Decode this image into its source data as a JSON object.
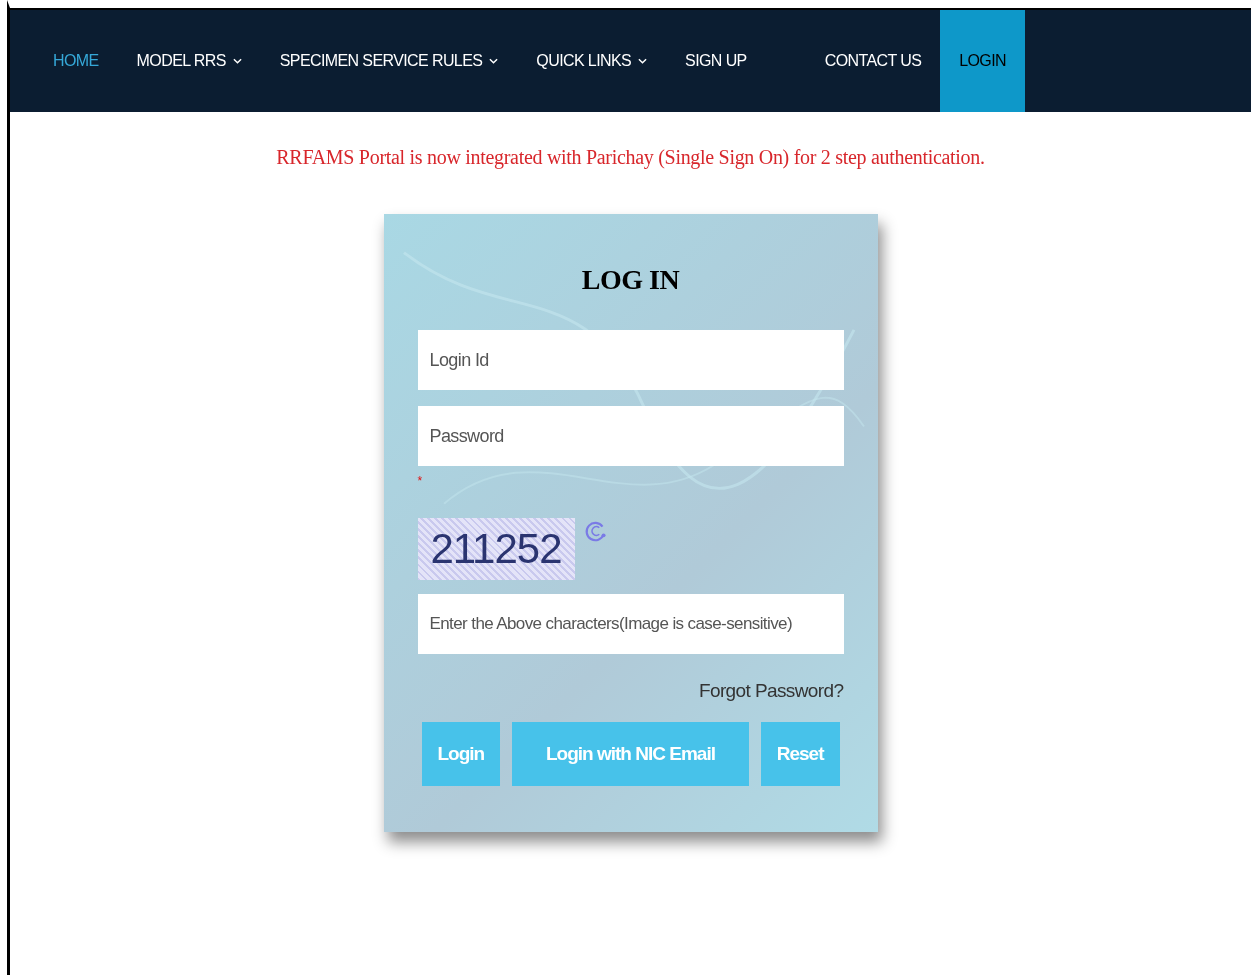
{
  "nav": {
    "items": [
      {
        "label": "HOME",
        "dropdown": false,
        "active": true,
        "selected": false
      },
      {
        "label": "MODEL RRS",
        "dropdown": true,
        "active": false,
        "selected": false
      },
      {
        "label": "SPECIMEN SERVICE RULES",
        "dropdown": true,
        "active": false,
        "selected": false
      },
      {
        "label": "QUICK LINKS",
        "dropdown": true,
        "active": false,
        "selected": false
      },
      {
        "label": "SIGN UP",
        "dropdown": false,
        "active": false,
        "selected": false
      },
      {
        "label": "CONTACT US",
        "dropdown": false,
        "active": false,
        "selected": false
      },
      {
        "label": "LOGIN",
        "dropdown": false,
        "active": false,
        "selected": true
      }
    ]
  },
  "notice": "RRFAMS Portal is now integrated with Parichay (Single Sign On) for 2 step authentication.",
  "login_card": {
    "title": "LOG IN",
    "login_id": {
      "placeholder": "Login Id"
    },
    "password": {
      "placeholder": "Password"
    },
    "required_mark": "*",
    "captcha": "211252",
    "captcha_input": {
      "placeholder": "Enter the Above characters(Image is case-sensitive)"
    },
    "forgot_password": "Forgot Password?",
    "buttons": [
      "Login",
      "Login with NIC Email",
      "Reset"
    ]
  }
}
